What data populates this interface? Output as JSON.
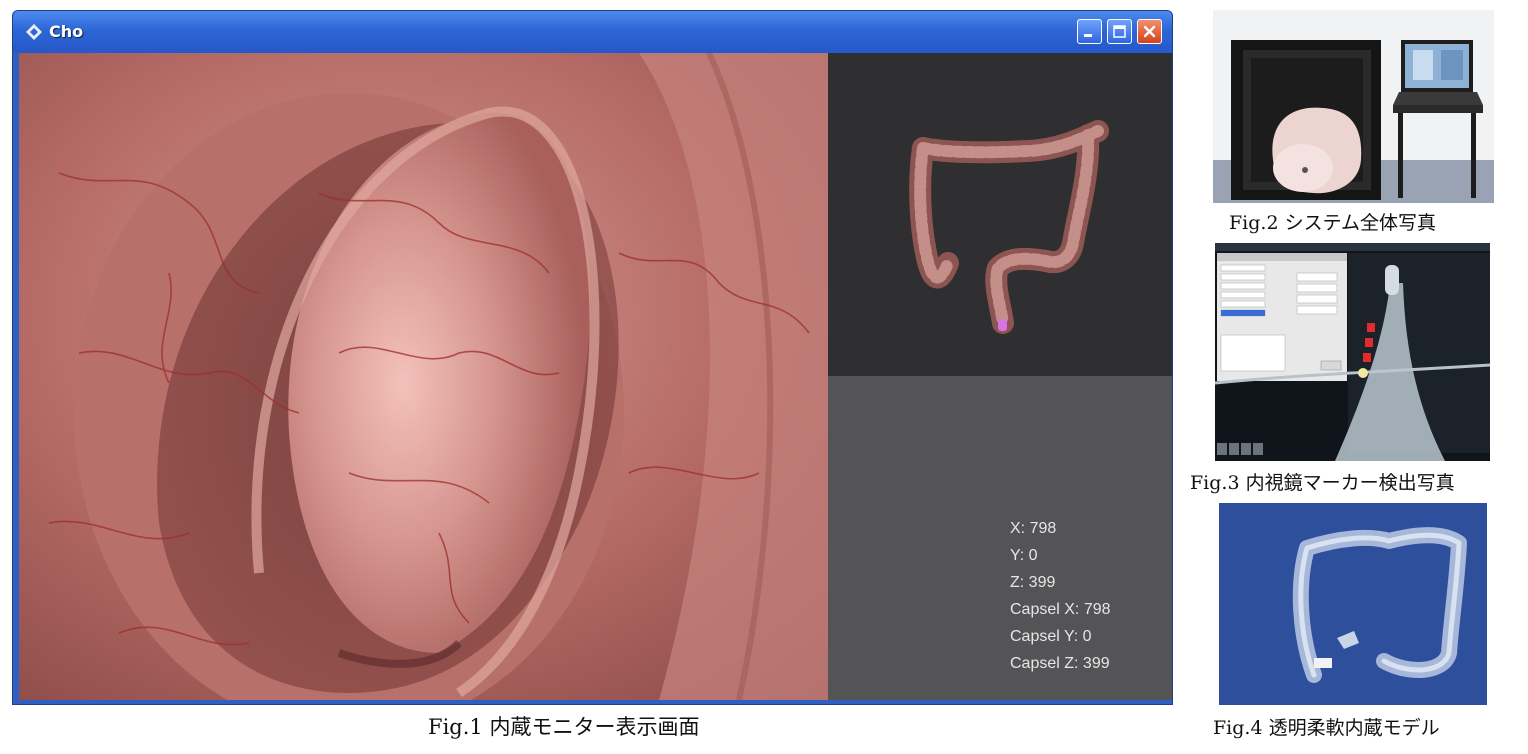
{
  "window": {
    "title": "Cho",
    "readout": {
      "x": "X: 798",
      "y": "Y: 0",
      "z": "Z: 399",
      "capsel_x": "Capsel X: 798",
      "capsel_y": "Capsel Y: 0",
      "capsel_z": "Capsel Z: 399"
    }
  },
  "captions": {
    "fig1": "Fig.1 内蔵モニター表示画面",
    "fig2": "Fig.2 システム全体写真",
    "fig3": "Fig.3 内視鏡マーカー検出写真",
    "fig4": "Fig.4 透明柔軟内蔵モデル"
  },
  "colors": {
    "titlebar": "#2e66d6",
    "close_button": "#d2421c",
    "tissue": "#b56a66",
    "side_panel_top": "#2f2f31",
    "side_panel_bottom": "#545457"
  },
  "icons": {
    "app": "unity-logo-icon",
    "minimize": "minimize-icon",
    "maximize": "maximize-icon",
    "close": "close-icon"
  }
}
